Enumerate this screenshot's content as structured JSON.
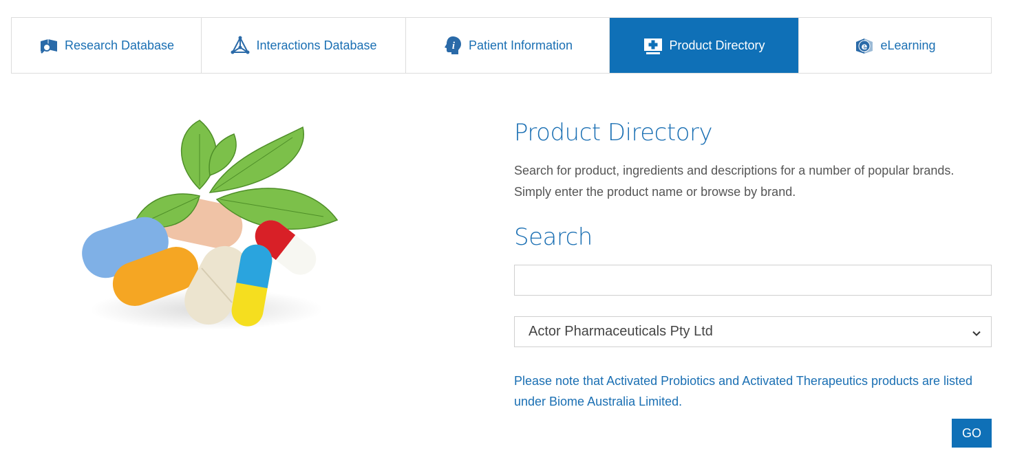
{
  "tabs": [
    {
      "label": "Research Database",
      "icon": "book-search-icon",
      "active": false
    },
    {
      "label": "Interactions Database",
      "icon": "molecule-icon",
      "active": false
    },
    {
      "label": "Patient Information",
      "icon": "info-head-icon",
      "active": false
    },
    {
      "label": "Product Directory",
      "icon": "medical-cross-icon",
      "active": true
    },
    {
      "label": "eLearning",
      "icon": "e-book-icon",
      "active": false
    }
  ],
  "main": {
    "title": "Product Directory",
    "description": "Search for product, ingredients and descriptions for a number of popular brands. Simply enter the product name or browse by brand.",
    "search_heading": "Search",
    "search_value": "",
    "brand_selected": "Actor Pharmaceuticals Pty Ltd",
    "note": "Please note that Activated Probiotics and Activated Therapeutics products are listed under Biome Australia Limited.",
    "go_label": "GO"
  },
  "colors": {
    "accent": "#0f70b7",
    "link": "#1a6fb3",
    "border": "#dcdcdc"
  }
}
